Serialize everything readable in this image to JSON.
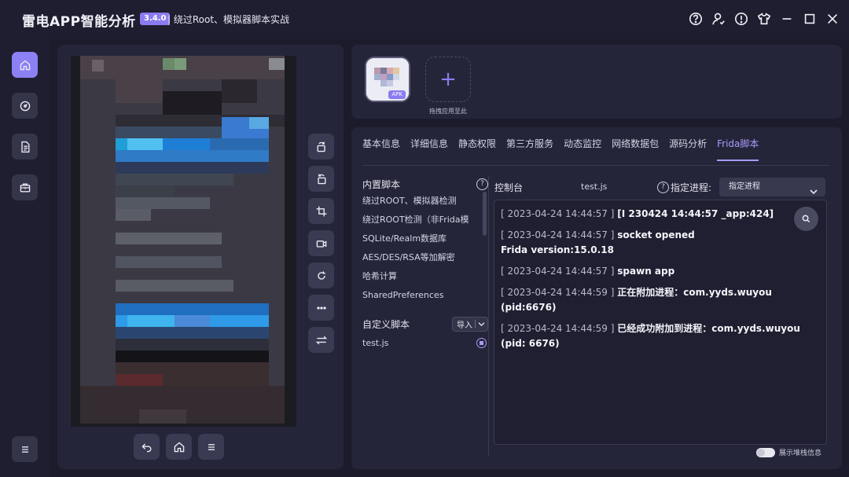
{
  "titlebar": {
    "app_title": "雷电APP智能分析",
    "version": "3.4.0",
    "subtitle": "| 绕过Root、模拟器脚本实战",
    "icons": [
      "help-icon",
      "user-icon",
      "info-icon",
      "shirt-icon",
      "minimize-icon",
      "maximize-icon",
      "close-icon"
    ]
  },
  "nav": {
    "items": [
      "home-icon",
      "dashboard-icon",
      "document-icon",
      "toolbox-icon"
    ],
    "bottom": "menu-icon"
  },
  "device": {
    "side_buttons": [
      "rotate-left-icon",
      "rotate-right-icon",
      "crop-icon",
      "record-icon",
      "refresh-icon",
      "more-icon",
      "swap-icon"
    ],
    "bottom_buttons": [
      "back-icon",
      "home-icon",
      "menu-icon"
    ]
  },
  "upload": {
    "apk_label": "APK",
    "add_caption": "拖拽应用至此"
  },
  "tabs": [
    "基本信息",
    "详细信息",
    "静态权限",
    "第三方服务",
    "动态监控",
    "网络数据包",
    "源码分析",
    "Frida脚本"
  ],
  "active_tab": "Frida脚本",
  "scripts": {
    "builtin_title": "内置脚本",
    "builtin": [
      "绕过ROOT、模拟器检测",
      "绕过ROOT检测（非Frida模",
      "SQLite/Realm数据库",
      "AES/DES/RSA等加解密",
      "哈希计算",
      "SharedPreferences"
    ],
    "custom_title": "自定义脚本",
    "import_label": "导入",
    "custom": [
      "test.js"
    ]
  },
  "console": {
    "title": "控制台",
    "file": "test.js",
    "process_label": "指定进程:",
    "process_value": "指定进程",
    "logs": [
      {
        "ts": "[ 2023-04-24 14:44:57 ]",
        "msg": "[I 230424 14:44:57 _app:424]"
      },
      {
        "ts": "[ 2023-04-24 14:44:57 ]",
        "msg": "socket opened",
        "extra": "Frida version:15.0.18"
      },
      {
        "ts": "[ 2023-04-24 14:44:57 ]",
        "msg": "spawn app"
      },
      {
        "ts": "[ 2023-04-24 14:44:59 ]",
        "msg": "正在附加进程：com.yyds.wuyou (pid:6676)"
      },
      {
        "ts": "[ 2023-04-24 14:44:59 ]",
        "msg": "已经成功附加到进程：com.yyds.wuyou (pid: 6676)"
      }
    ]
  },
  "stack_toggle": {
    "label": "展示堆栈信息",
    "on": false
  },
  "colors": {
    "accent": "#8a7cf0",
    "bg": "#1b1b2c",
    "panel": "#25253a"
  }
}
